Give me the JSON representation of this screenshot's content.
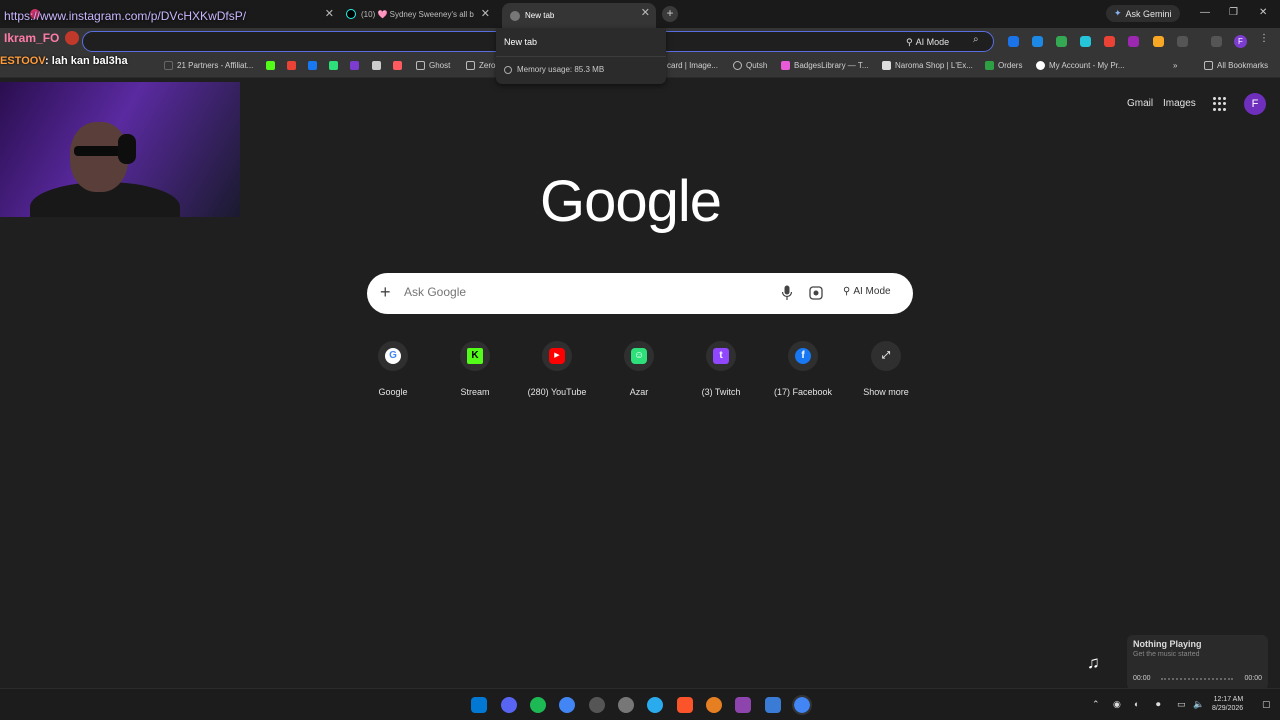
{
  "tabs": [
    {
      "title": "",
      "active": false
    },
    {
      "title": "(10) 🩷 Sydney Sweeney's all b",
      "active": false
    },
    {
      "title": "New tab",
      "active": true
    }
  ],
  "new_tab_button": "+",
  "ask_gemini": "Ask Gemini",
  "omnibox": {
    "ai_mode_label": "AI Mode"
  },
  "bookmarks": [
    {
      "label": "21 Partners - Affiliat...",
      "color": "#2c2c2c"
    },
    {
      "label": "Ghost",
      "color": "#888888"
    },
    {
      "label": "Zero",
      "color": "#888888"
    },
    {
      "label": "card | Image...",
      "color": "#555555"
    },
    {
      "label": "Qutsh",
      "color": "#aaaaaa"
    },
    {
      "label": "BadgesLibrary — T...",
      "color": "#e85bd8"
    },
    {
      "label": "Naroma Shop | L'Ex...",
      "color": "#dddddd"
    },
    {
      "label": "Orders",
      "color": "#2ea043"
    },
    {
      "label": "My Account - My Pr...",
      "color": "#ffffff"
    },
    {
      "label": "All Bookmarks",
      "color": "#888888"
    }
  ],
  "hover_card": {
    "title": "New tab",
    "memory": "Memory usage: 85.3 MB"
  },
  "stream_overlay": {
    "url": "https://www.instagram.com/p/DVcHXKwDfsP/",
    "username": "Ikram_FO",
    "chat_name": "ESTOOV",
    "chat_message": ": lah kan bal3ha"
  },
  "ntp": {
    "gmail": "Gmail",
    "images": "Images",
    "avatar_letter": "F",
    "logo": "Google",
    "search_placeholder": "Ask Google",
    "ai_mode": "AI Mode",
    "shortcuts": [
      {
        "label": "Google",
        "icon": "google-icon",
        "color": "#4285f4",
        "glyph": "G"
      },
      {
        "label": "Stream",
        "icon": "kick-icon",
        "color": "#53fc18",
        "glyph": "K"
      },
      {
        "label": "(280) YouTube",
        "icon": "youtube-icon",
        "color": "#ff0000",
        "glyph": "▶"
      },
      {
        "label": "Azar",
        "icon": "azar-icon",
        "color": "#2ee07a",
        "glyph": "☺"
      },
      {
        "label": "(3) Twitch",
        "icon": "twitch-icon",
        "color": "#9146ff",
        "glyph": "t"
      },
      {
        "label": "(17) Facebook",
        "icon": "facebook-icon",
        "color": "#1877f2",
        "glyph": "f"
      },
      {
        "label": "Show more",
        "icon": "expand-icon",
        "color": "#2f2f2f",
        "glyph": "⤢"
      }
    ]
  },
  "media_widget": {
    "title": "Nothing Playing",
    "subtitle": "Get the music started",
    "time_start": "00:00",
    "time_end": "00:00"
  },
  "taskbar": {
    "time": "12:17 AM",
    "date": "8/29/2026"
  }
}
